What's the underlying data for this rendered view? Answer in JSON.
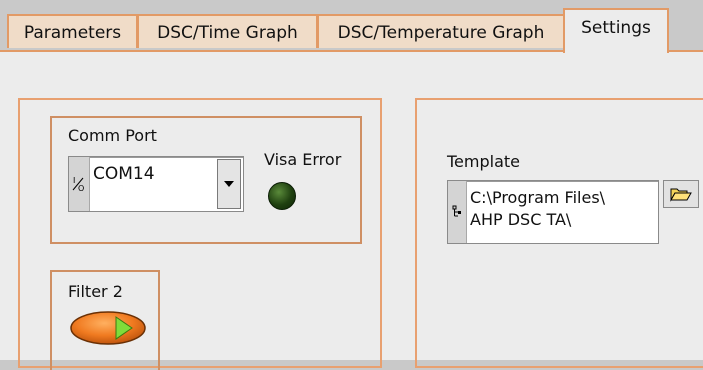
{
  "tabs": [
    {
      "label": "Parameters"
    },
    {
      "label": "DSC/Time Graph"
    },
    {
      "label": "DSC/Temperature Graph"
    },
    {
      "label": "Settings"
    }
  ],
  "active_tab": "Settings",
  "comm_port": {
    "label": "Comm Port",
    "prefix": "I/O",
    "value": "COM14"
  },
  "visa_error": {
    "label": "Visa Error",
    "state": "off",
    "color": "#1f4010"
  },
  "filter": {
    "label": "Filter 2",
    "button_color": "#f07a20",
    "indicator_color": "#7fdc3a"
  },
  "template": {
    "label": "Template",
    "path": "C:\\Program Files\\\nAHP DSC TA\\"
  },
  "colors": {
    "frame": "#e8a070",
    "tab_inactive": "#f0dcc8",
    "panel": "#ececec"
  }
}
